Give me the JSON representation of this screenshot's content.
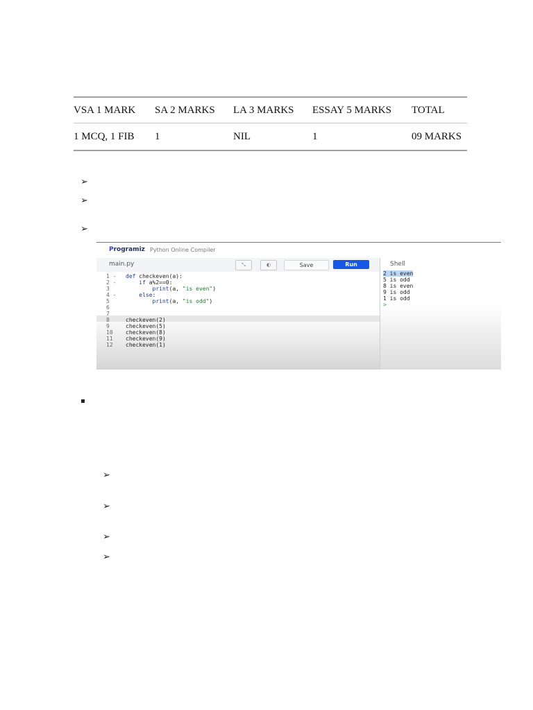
{
  "marks_table": {
    "headers": [
      "VSA 1 MARK",
      "SA 2 MARKS",
      "LA 3 MARKS",
      "ESSAY 5 MARKS",
      "TOTAL"
    ],
    "row": [
      "1 MCQ, 1 FIB",
      "1",
      "NIL",
      "1",
      "09 MARKS"
    ]
  },
  "bullet_glyph": "➢",
  "compiler": {
    "logo_text": "rogramiz",
    "logo_initial": "P",
    "app_title": "Python Online Compiler",
    "file_tab": "main.py",
    "save_label": "Save",
    "run_label": "Run",
    "shell_label": "Shell",
    "code_lines": [
      {
        "num": "1 -",
        "code": "def checkeven(a):"
      },
      {
        "num": "2 -",
        "code": "    if a%2==0:"
      },
      {
        "num": "3",
        "code": "        print(a, \"is even\")"
      },
      {
        "num": "4 -",
        "code": "    else:"
      },
      {
        "num": "5",
        "code": "        print(a, \"is odd\")"
      },
      {
        "num": "6",
        "code": ""
      },
      {
        "num": "7",
        "code": ""
      },
      {
        "num": "8",
        "code": "checkeven(2)"
      },
      {
        "num": "9",
        "code": "checkeven(5)"
      },
      {
        "num": "10",
        "code": "checkeven(8)"
      },
      {
        "num": "11",
        "code": "checkeven(9)"
      },
      {
        "num": "12",
        "code": "checkeven(1)"
      }
    ],
    "shell_output": [
      "2 is even",
      "5 is odd",
      "8 is even",
      "9 is odd",
      "1 is odd",
      ">"
    ]
  },
  "colors": {
    "run_button": "#1657e6",
    "keyword": "#1a3a9e",
    "string": "#1b7d2c"
  }
}
